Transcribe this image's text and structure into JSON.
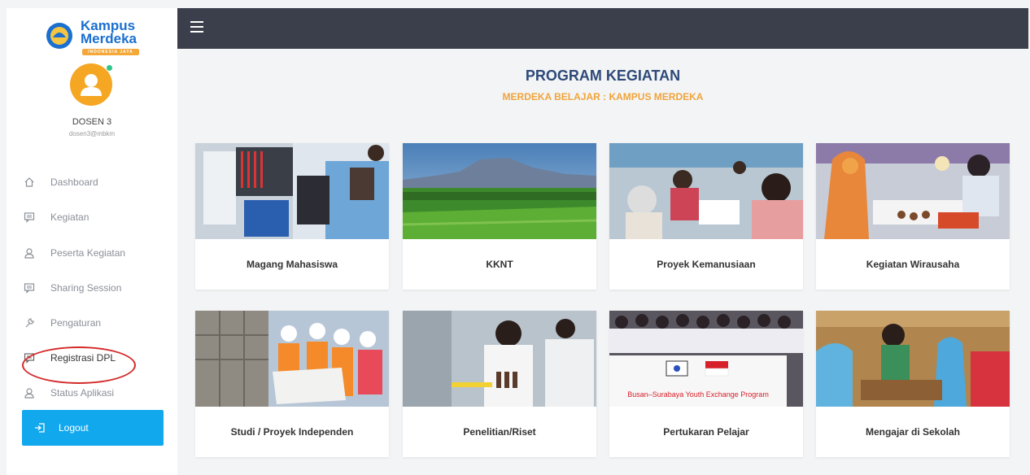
{
  "brand": {
    "line1": "Kampus",
    "line2": "Merdeka",
    "tagline": "INDONESIA JAYA"
  },
  "user": {
    "name": "DOSEN 3",
    "email": "dosen3@mbkm"
  },
  "sidebar": {
    "items": [
      {
        "label": "Dashboard",
        "icon": "home-icon"
      },
      {
        "label": "Kegiatan",
        "icon": "chat-icon"
      },
      {
        "label": "Peserta Kegiatan",
        "icon": "user-icon"
      },
      {
        "label": "Sharing Session",
        "icon": "chat-icon"
      },
      {
        "label": "Pengaturan",
        "icon": "wrench-icon"
      },
      {
        "label": "Registrasi DPL",
        "icon": "chat-icon"
      },
      {
        "label": "Status Aplikasi",
        "icon": "user-icon"
      }
    ],
    "logout": "Logout"
  },
  "main": {
    "title": "PROGRAM KEGIATAN",
    "subtitle": "MERDEKA BELAJAR : KAMPUS MERDEKA",
    "programs": [
      {
        "label": "Magang Mahasiswa",
        "scene": "lab-workers"
      },
      {
        "label": "KKNT",
        "scene": "rice-field-volcano"
      },
      {
        "label": "Proyek Kemanusiaan",
        "scene": "volunteers"
      },
      {
        "label": "Kegiatan Wirausaha",
        "scene": "market-stall"
      },
      {
        "label": "Studi / Proyek Independen",
        "scene": "construction-students"
      },
      {
        "label": "Penelitian/Riset",
        "scene": "lab-research"
      },
      {
        "label": "Pertukaran Pelajar",
        "scene": "exchange-group"
      },
      {
        "label": "Mengajar di Sekolah",
        "scene": "classroom"
      }
    ],
    "exchange_banner": "Busan–Surabaya Youth Exchange Program"
  },
  "colors": {
    "topbar": "#3b3f4c",
    "title": "#2e4a78",
    "subtitle": "#f0a43a",
    "logout": "#12a8ee",
    "avatar": "#f5a623",
    "annotation": "#d42a2a"
  }
}
